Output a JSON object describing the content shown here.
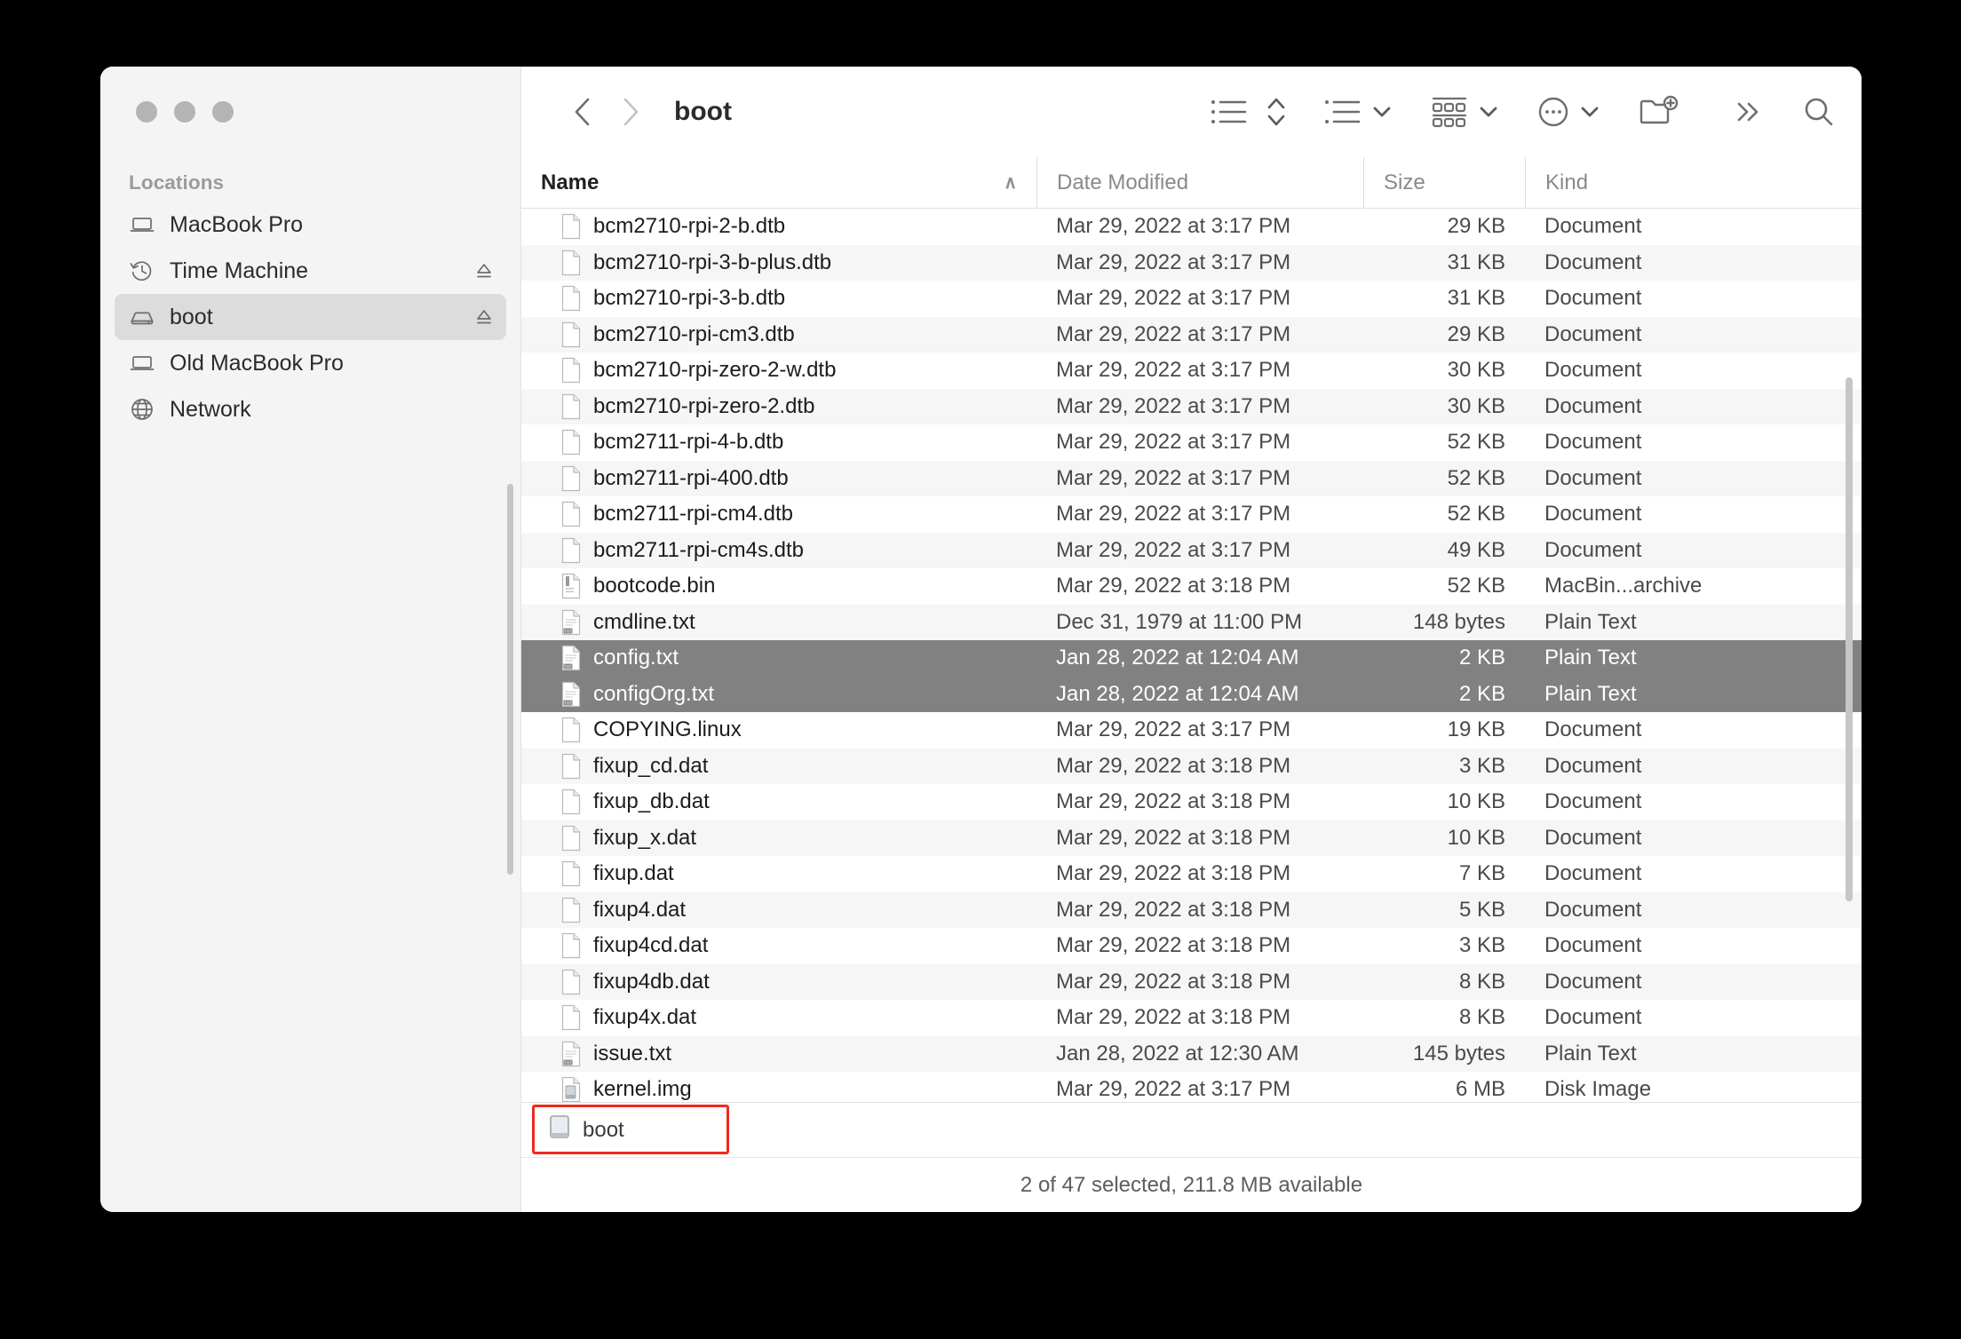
{
  "window": {
    "traffic_lights": [
      "close",
      "minimize",
      "zoom"
    ],
    "folder_title": "boot"
  },
  "sidebar": {
    "section_label": "Locations",
    "items": [
      {
        "label": "MacBook Pro",
        "icon": "laptop-icon",
        "eject": false,
        "selected": false
      },
      {
        "label": "Time Machine",
        "icon": "time-machine-icon",
        "eject": true,
        "selected": false
      },
      {
        "label": "boot",
        "icon": "drive-icon",
        "eject": true,
        "selected": true
      },
      {
        "label": "Old MacBook Pro",
        "icon": "laptop-icon",
        "eject": false,
        "selected": false
      },
      {
        "label": "Network",
        "icon": "globe-icon",
        "eject": false,
        "selected": false
      }
    ]
  },
  "toolbar": {
    "back": "back-icon",
    "forward": "forward-icon",
    "view_list": "list-view-icon",
    "sort": "sort-arrows-icon",
    "group": "group-by-icon",
    "arrange": "arrange-icon",
    "actions": "more-actions-icon",
    "new_folder": "new-folder-icon",
    "overflow": "overflow-chevrons-icon",
    "search": "search-icon"
  },
  "columns": {
    "name": "Name",
    "date_modified": "Date Modified",
    "size": "Size",
    "kind": "Kind",
    "sort_caret": "∧"
  },
  "files": [
    {
      "name": "bcm2710-rpi-2-b.dtb",
      "date": "Mar 29, 2022 at 3:17 PM",
      "size": "29 KB",
      "kind": "Document",
      "icon": "blank-doc-icon",
      "selected": false
    },
    {
      "name": "bcm2710-rpi-3-b-plus.dtb",
      "date": "Mar 29, 2022 at 3:17 PM",
      "size": "31 KB",
      "kind": "Document",
      "icon": "blank-doc-icon",
      "selected": false
    },
    {
      "name": "bcm2710-rpi-3-b.dtb",
      "date": "Mar 29, 2022 at 3:17 PM",
      "size": "31 KB",
      "kind": "Document",
      "icon": "blank-doc-icon",
      "selected": false
    },
    {
      "name": "bcm2710-rpi-cm3.dtb",
      "date": "Mar 29, 2022 at 3:17 PM",
      "size": "29 KB",
      "kind": "Document",
      "icon": "blank-doc-icon",
      "selected": false
    },
    {
      "name": "bcm2710-rpi-zero-2-w.dtb",
      "date": "Mar 29, 2022 at 3:17 PM",
      "size": "30 KB",
      "kind": "Document",
      "icon": "blank-doc-icon",
      "selected": false
    },
    {
      "name": "bcm2710-rpi-zero-2.dtb",
      "date": "Mar 29, 2022 at 3:17 PM",
      "size": "30 KB",
      "kind": "Document",
      "icon": "blank-doc-icon",
      "selected": false
    },
    {
      "name": "bcm2711-rpi-4-b.dtb",
      "date": "Mar 29, 2022 at 3:17 PM",
      "size": "52 KB",
      "kind": "Document",
      "icon": "blank-doc-icon",
      "selected": false
    },
    {
      "name": "bcm2711-rpi-400.dtb",
      "date": "Mar 29, 2022 at 3:17 PM",
      "size": "52 KB",
      "kind": "Document",
      "icon": "blank-doc-icon",
      "selected": false
    },
    {
      "name": "bcm2711-rpi-cm4.dtb",
      "date": "Mar 29, 2022 at 3:17 PM",
      "size": "52 KB",
      "kind": "Document",
      "icon": "blank-doc-icon",
      "selected": false
    },
    {
      "name": "bcm2711-rpi-cm4s.dtb",
      "date": "Mar 29, 2022 at 3:17 PM",
      "size": "49 KB",
      "kind": "Document",
      "icon": "blank-doc-icon",
      "selected": false
    },
    {
      "name": "bootcode.bin",
      "date": "Mar 29, 2022 at 3:18 PM",
      "size": "52 KB",
      "kind": "MacBin...archive",
      "icon": "binary-doc-icon",
      "selected": false
    },
    {
      "name": "cmdline.txt",
      "date": "Dec 31, 1979 at 11:00 PM",
      "size": "148 bytes",
      "kind": "Plain Text",
      "icon": "text-doc-icon",
      "selected": false
    },
    {
      "name": "config.txt",
      "date": "Jan 28, 2022 at 12:04 AM",
      "size": "2 KB",
      "kind": "Plain Text",
      "icon": "text-doc-icon",
      "selected": true
    },
    {
      "name": "configOrg.txt",
      "date": "Jan 28, 2022 at 12:04 AM",
      "size": "2 KB",
      "kind": "Plain Text",
      "icon": "text-doc-icon",
      "selected": true
    },
    {
      "name": "COPYING.linux",
      "date": "Mar 29, 2022 at 3:17 PM",
      "size": "19 KB",
      "kind": "Document",
      "icon": "blank-doc-icon",
      "selected": false
    },
    {
      "name": "fixup_cd.dat",
      "date": "Mar 29, 2022 at 3:18 PM",
      "size": "3 KB",
      "kind": "Document",
      "icon": "blank-doc-icon",
      "selected": false
    },
    {
      "name": "fixup_db.dat",
      "date": "Mar 29, 2022 at 3:18 PM",
      "size": "10 KB",
      "kind": "Document",
      "icon": "blank-doc-icon",
      "selected": false
    },
    {
      "name": "fixup_x.dat",
      "date": "Mar 29, 2022 at 3:18 PM",
      "size": "10 KB",
      "kind": "Document",
      "icon": "blank-doc-icon",
      "selected": false
    },
    {
      "name": "fixup.dat",
      "date": "Mar 29, 2022 at 3:18 PM",
      "size": "7 KB",
      "kind": "Document",
      "icon": "blank-doc-icon",
      "selected": false
    },
    {
      "name": "fixup4.dat",
      "date": "Mar 29, 2022 at 3:18 PM",
      "size": "5 KB",
      "kind": "Document",
      "icon": "blank-doc-icon",
      "selected": false
    },
    {
      "name": "fixup4cd.dat",
      "date": "Mar 29, 2022 at 3:18 PM",
      "size": "3 KB",
      "kind": "Document",
      "icon": "blank-doc-icon",
      "selected": false
    },
    {
      "name": "fixup4db.dat",
      "date": "Mar 29, 2022 at 3:18 PM",
      "size": "8 KB",
      "kind": "Document",
      "icon": "blank-doc-icon",
      "selected": false
    },
    {
      "name": "fixup4x.dat",
      "date": "Mar 29, 2022 at 3:18 PM",
      "size": "8 KB",
      "kind": "Document",
      "icon": "blank-doc-icon",
      "selected": false
    },
    {
      "name": "issue.txt",
      "date": "Jan 28, 2022 at 12:30 AM",
      "size": "145 bytes",
      "kind": "Plain Text",
      "icon": "text-doc-icon",
      "selected": false
    },
    {
      "name": "kernel.img",
      "date": "Mar 29, 2022 at 3:17 PM",
      "size": "6 MB",
      "kind": "Disk Image",
      "icon": "disk-image-icon",
      "selected": false
    }
  ],
  "pathbar": {
    "current": "boot",
    "icon": "drive-icon"
  },
  "statusbar": {
    "text": "2 of 47 selected, 211.8 MB available"
  },
  "colors": {
    "selection": "#818181",
    "annotation": "#ef2b1e",
    "sidebar_bg": "#f4f4f4",
    "row_alt": "#f6f6f6"
  }
}
